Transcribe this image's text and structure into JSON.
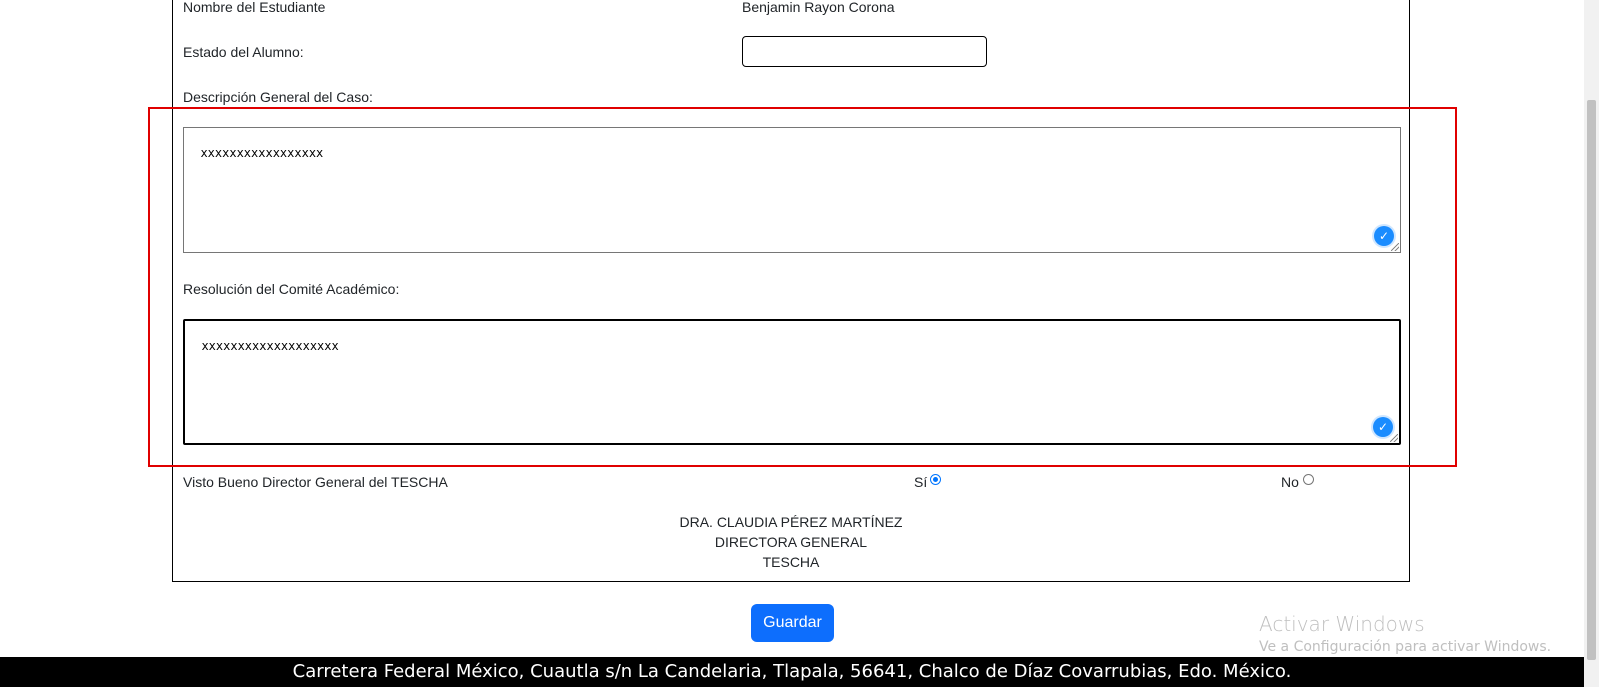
{
  "form": {
    "student_name_label": "Nombre del Estudiante",
    "student_name_value": "Benjamin Rayon Corona",
    "student_status_label": "Estado del Alumno:",
    "student_status_value": "",
    "case_description_label": "Descripción General del Caso:",
    "case_description_value": "xxxxxxxxxxxxxxxxx",
    "committee_resolution_label": "Resolución del Comité Académico:",
    "committee_resolution_value": "xxxxxxxxxxxxxxxxxxx",
    "approval_label": "Visto Bueno Director General del TESCHA",
    "approval_yes_label": "Sí",
    "approval_no_label": "No",
    "approval_selected": "Sí"
  },
  "signature": {
    "name": "DRA. CLAUDIA PÉREZ MARTÍNEZ",
    "title": "DIRECTORA GENERAL",
    "institution": "TESCHA"
  },
  "actions": {
    "save_label": "Guardar"
  },
  "watermark": {
    "title": "Activar Windows",
    "subtitle": "Ve a Configuración para activar Windows."
  },
  "footer": {
    "address": "Carretera Federal México, Cuautla s/n La Candelaria, Tlapala, 56641, Chalco de Díaz Covarrubias, Edo. México."
  },
  "colors": {
    "primary_button": "#0d6efd",
    "highlight_border": "#e00000",
    "footer_bg": "#000000",
    "radio_accent": "#0075ff"
  },
  "icons": [
    "grammar-check-icon",
    "resize-grip-icon",
    "radio-checked-icon",
    "radio-unchecked-icon"
  ]
}
